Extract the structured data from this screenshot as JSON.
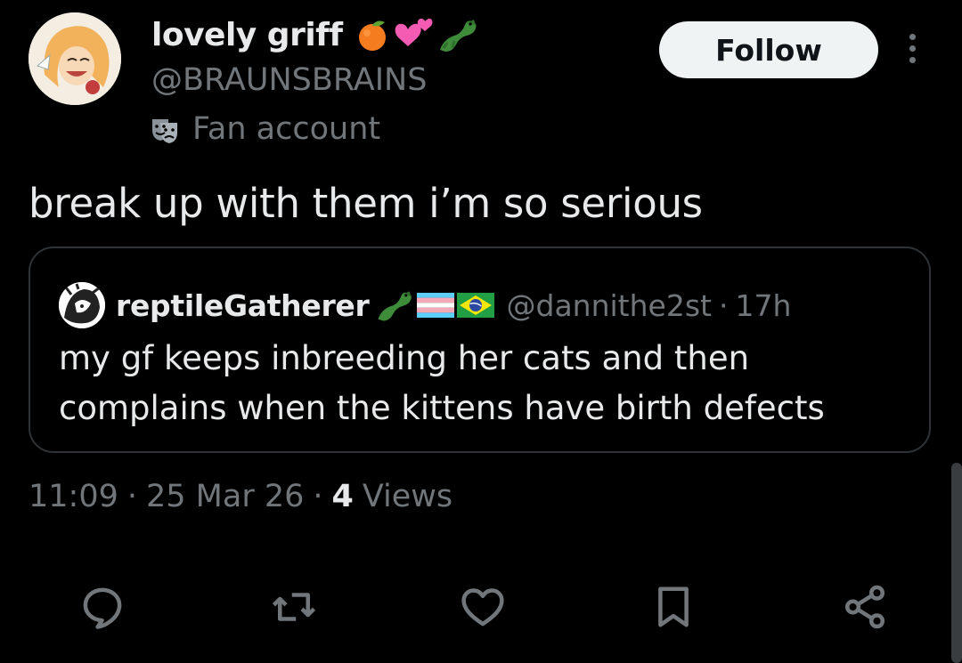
{
  "author": {
    "display_name": "lovely griff",
    "name_emojis": [
      "tangerine-emoji",
      "two-hearts-emoji",
      "crocodile-emoji"
    ],
    "handle": "@BRAUNSBRAINS",
    "account_label": "Fan account",
    "label_icon": "performing-arts-icon"
  },
  "follow_button": {
    "label": "Follow"
  },
  "more_button": {
    "icon": "more-vertical-icon"
  },
  "tweet": {
    "text": "break up with them i’m so serious"
  },
  "quoted_tweet": {
    "display_name": "reptileGatherer",
    "name_emojis": [
      "crocodile-emoji",
      "transgender-flag-emoji",
      "brazil-flag-emoji"
    ],
    "handle": "@dannithe2st",
    "separator": "·",
    "time": "17h",
    "text": "my gf keeps inbreeding her cats and then complains when the kittens have birth defects"
  },
  "meta": {
    "time": "11:09",
    "separator": "·",
    "date": "25 Mar 26",
    "views_count": "4",
    "views_label": "Views"
  },
  "actions": [
    {
      "name": "reply",
      "icon": "reply-icon"
    },
    {
      "name": "repost",
      "icon": "repost-icon"
    },
    {
      "name": "like",
      "icon": "heart-icon"
    },
    {
      "name": "bookmark",
      "icon": "bookmark-icon"
    },
    {
      "name": "share",
      "icon": "share-icon"
    }
  ],
  "colors": {
    "background": "#000000",
    "primary_text": "#e7e9ea",
    "secondary_text": "#71767b",
    "border": "#2f3336",
    "follow_button_bg": "#eff3f4"
  }
}
